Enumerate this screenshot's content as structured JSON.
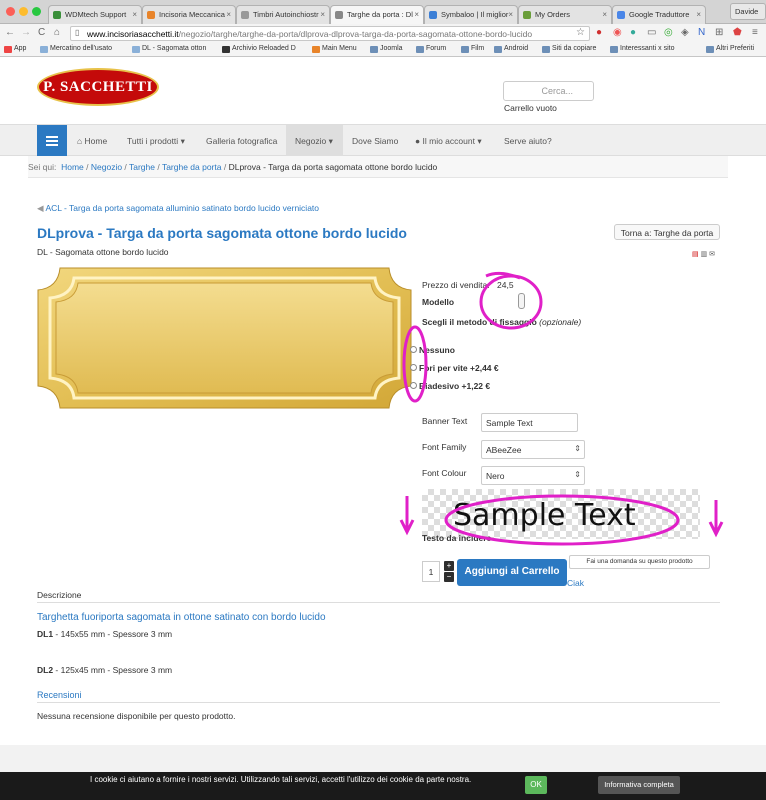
{
  "browser": {
    "tabs": [
      {
        "label": "WDMtech Support"
      },
      {
        "label": "Incisoria Meccanica"
      },
      {
        "label": "Timbri Autoinchiostr"
      },
      {
        "label": "Targhe da porta : Dl"
      },
      {
        "label": "Symbaloo | Il miglior"
      },
      {
        "label": "My Orders"
      },
      {
        "label": "Google Traduttore"
      }
    ],
    "profile": "Davide",
    "url_domain": "www.incisoriasacchetti.it",
    "url_path": "/negozio/targhe/targhe-da-porta/dlprova-dlprova-targa-da-porta-sagomata-ottone-bordo-lucido",
    "bookmarks": [
      {
        "label": "App"
      },
      {
        "label": "Mercatino dell'usato"
      },
      {
        "label": "DL - Sagomata otton"
      },
      {
        "label": "Archivio Reloaded D"
      },
      {
        "label": "Main Menu"
      },
      {
        "label": "Joomla"
      },
      {
        "label": "Forum"
      },
      {
        "label": "Film"
      },
      {
        "label": "Android"
      },
      {
        "label": "Siti da copiare"
      },
      {
        "label": "Interessanti x sito"
      },
      {
        "label": "Altri Preferiti"
      }
    ]
  },
  "header": {
    "logo": "P. SACCHETTI",
    "search_placeholder": "Cerca...",
    "cart_status": "Carrello vuoto"
  },
  "nav": {
    "items": [
      {
        "label": "Home"
      },
      {
        "label": "Tutti i prodotti"
      },
      {
        "label": "Galleria fotografica"
      },
      {
        "label": "Negozio"
      },
      {
        "label": "Dove Siamo"
      },
      {
        "label": "Il mio account"
      },
      {
        "label": "Serve aiuto?"
      }
    ]
  },
  "breadcrumb": {
    "prefix": "Sei qui:",
    "items": [
      "Home",
      "Negozio",
      "Targhe",
      "Targhe da porta",
      "DLprova - Targa da porta sagomata ottone bordo lucido"
    ]
  },
  "product": {
    "prev_link": "ACL - Targa da porta sagomata alluminio satinato bordo lucido verniciato",
    "title": "DLprova - Targa da porta sagomata ottone bordo lucido",
    "subtitle": "DL - Sagomata ottone bordo lucido",
    "back_button": "Torna a: Targhe da porta",
    "price_label": "Prezzo di vendita:",
    "price_value": "24,5",
    "model_label": "Modello",
    "fixing_label": "Scegli il metodo di fissaggio",
    "fixing_optional": "(opzionale)",
    "fixing_options": [
      "Nessuno",
      "Fori per vite +2,44 €",
      "Biadesivo +1,22 €"
    ],
    "banner_text_label": "Banner Text",
    "banner_text_value": "Sample Text",
    "font_family_label": "Font Family",
    "font_family_value": "ABeeZee",
    "font_colour_label": "Font Colour",
    "font_colour_value": "Nero",
    "preview_text": "Sample Text",
    "engrave_label": "Testo da incidere",
    "qty": "1",
    "add_to_cart": "Aggiungi al Carrello",
    "ask_question": "Fai una domanda su questo prodotto",
    "extra_link": "Ciak"
  },
  "description": {
    "heading": "Descrizione",
    "subheading": "Targhetta fuoriporta sagomata in ottone satinato con bordo lucido",
    "lines": [
      {
        "code": "DL1",
        "text": " - 145x55 mm - Spessore 3 mm"
      },
      {
        "code": "DL2",
        "text": " - 125x45 mm - Spessore 3 mm"
      }
    ],
    "reviews_heading": "Recensioni",
    "reviews_text": "Nessuna recensione disponibile per questo prodotto."
  },
  "cookie": {
    "text": "I cookie ci aiutano a fornire i nostri servizi. Utilizzando tali servizi, accetti l'utilizzo dei cookie da parte nostra.",
    "ok": "OK",
    "info": "Informativa completa"
  },
  "colors": {
    "accent": "#2b79c2",
    "annotation": "#e020c8"
  }
}
